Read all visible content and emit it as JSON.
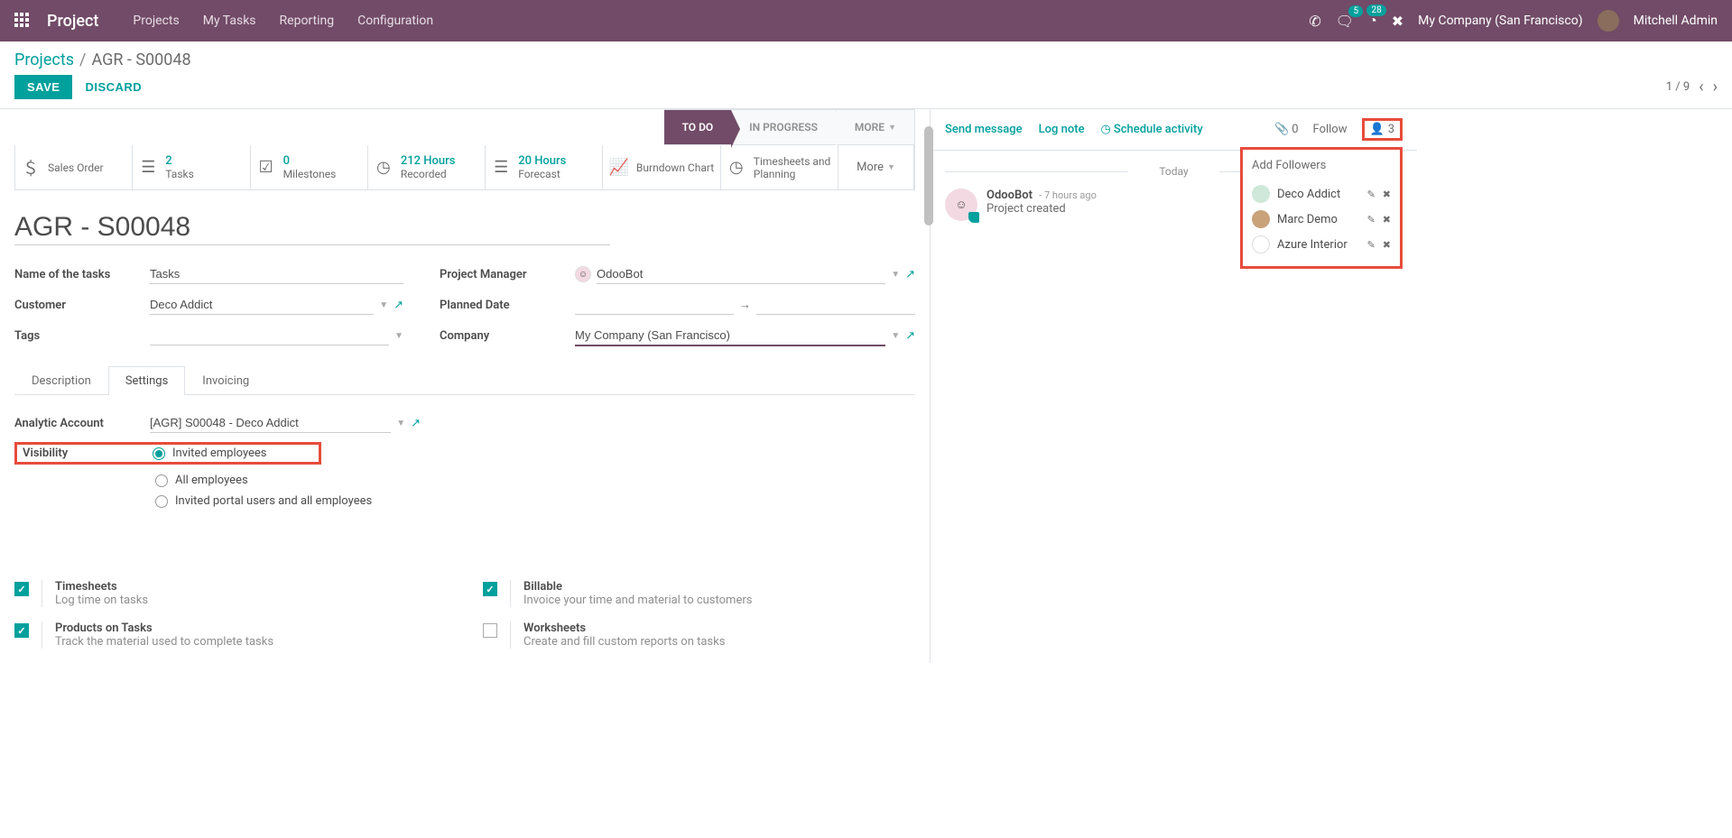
{
  "navbar": {
    "app_title": "Project",
    "menu": [
      "Projects",
      "My Tasks",
      "Reporting",
      "Configuration"
    ],
    "chat_badge": "5",
    "clock_badge": "28",
    "company": "My Company (San Francisco)",
    "user": "Mitchell Admin"
  },
  "breadcrumb": {
    "root": "Projects",
    "current": "AGR - S00048"
  },
  "actions": {
    "save": "SAVE",
    "discard": "DISCARD",
    "page": "1 / 9"
  },
  "status": {
    "todo": "TO DO",
    "in_progress": "IN PROGRESS",
    "more": "MORE"
  },
  "stats": {
    "sales_order": "Sales Order",
    "tasks_val": "2",
    "tasks_lbl": "Tasks",
    "milestones_val": "0",
    "milestones_lbl": "Milestones",
    "recorded_val": "212 Hours",
    "recorded_lbl": "Recorded",
    "forecast_val": "20 Hours",
    "forecast_lbl": "Forecast",
    "burndown_lbl": "Burndown Chart",
    "timesheets_lbl": "Timesheets and Planning",
    "more": "More"
  },
  "title": "AGR - S00048",
  "fields": {
    "name_of_tasks_lbl": "Name of the tasks",
    "name_of_tasks_val": "Tasks",
    "customer_lbl": "Customer",
    "customer_val": "Deco Addict",
    "tags_lbl": "Tags",
    "tags_val": "",
    "pm_lbl": "Project Manager",
    "pm_val": "OdooBot",
    "planned_lbl": "Planned Date",
    "company_lbl": "Company",
    "company_val": "My Company (San Francisco)"
  },
  "tabs": {
    "description": "Description",
    "settings": "Settings",
    "invoicing": "Invoicing"
  },
  "settings": {
    "analytic_lbl": "Analytic Account",
    "analytic_val": "[AGR] S00048 - Deco Addict",
    "visibility_lbl": "Visibility",
    "vis_opt1": "Invited employees",
    "vis_opt2": "All employees",
    "vis_opt3": "Invited portal users and all employees"
  },
  "features": {
    "timesheets_t": "Timesheets",
    "timesheets_d": "Log time on tasks",
    "billable_t": "Billable",
    "billable_d": "Invoice your time and material to customers",
    "products_t": "Products on Tasks",
    "products_d": "Track the material used to complete tasks",
    "worksheets_t": "Worksheets",
    "worksheets_d": "Create and fill custom reports on tasks"
  },
  "chatter": {
    "send": "Send message",
    "log": "Log note",
    "schedule": "Schedule activity",
    "attach_count": "0",
    "follow": "Follow",
    "follower_count": "3",
    "today": "Today",
    "msg_author": "OdooBot",
    "msg_time": "- 7 hours ago",
    "msg_body": "Project created"
  },
  "followers": {
    "title": "Add Followers",
    "items": [
      "Deco Addict",
      "Marc Demo",
      "Azure Interior"
    ]
  }
}
